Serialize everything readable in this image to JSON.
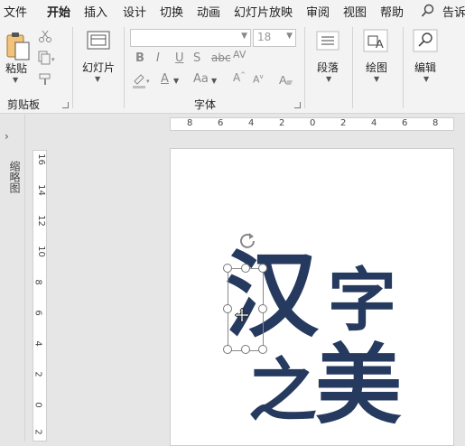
{
  "menu": {
    "tabs": [
      "文件",
      "开始",
      "插入",
      "设计",
      "切换",
      "动画",
      "幻灯片放映",
      "审阅",
      "视图",
      "帮助"
    ],
    "active_tab": "开始",
    "tell_me": "告诉"
  },
  "ribbon": {
    "clipboard": {
      "paste_label": "粘贴",
      "group_label": "剪贴板"
    },
    "slides": {
      "new_slide_label": "幻灯片"
    },
    "font": {
      "group_label": "字体",
      "font_name": "",
      "font_size": "18",
      "format_buttons": [
        "B",
        "I",
        "U",
        "S",
        "abc",
        "AV"
      ],
      "color_buttons": [
        "Aa",
        "A",
        "A"
      ]
    },
    "paragraph": {
      "label": "段落"
    },
    "drawing": {
      "label": "绘图"
    },
    "editing": {
      "label": "编辑"
    }
  },
  "rulers": {
    "horizontal": [
      "8",
      "6",
      "4",
      "2",
      "0",
      "2",
      "4",
      "6",
      "8"
    ],
    "vertical": [
      "16",
      "14",
      "12",
      "10",
      "8",
      "6",
      "4",
      "2",
      "0",
      "2"
    ]
  },
  "thumbnail_panel": {
    "label": "缩略图"
  },
  "slide": {
    "chars": [
      "汉",
      "字",
      "之",
      "美"
    ],
    "text_color": "#253a5e"
  }
}
